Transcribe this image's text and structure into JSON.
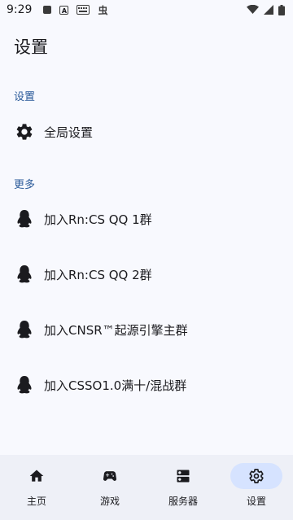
{
  "status_bar": {
    "time": "9:29",
    "icons": [
      "square-notification-icon",
      "font-a-icon",
      "keyboard-icon",
      "app-glyph-icon",
      "wifi-icon",
      "signal-icon",
      "battery-icon"
    ],
    "glyph": "虫"
  },
  "page_title": "设置",
  "sections": [
    {
      "header": "设置",
      "items": [
        {
          "label": "全局设置",
          "icon": "gear-icon"
        }
      ]
    },
    {
      "header": "更多",
      "items": [
        {
          "label": "加入Rn:CS QQ 1群",
          "icon": "qq-penguin-icon"
        },
        {
          "label": "加入Rn:CS QQ 2群",
          "icon": "qq-penguin-icon"
        },
        {
          "label": "加入CNSR™起源引擎主群",
          "icon": "qq-penguin-icon"
        },
        {
          "label": "加入CSSO1.0满十/混战群",
          "icon": "qq-penguin-icon"
        }
      ]
    }
  ],
  "bottom_nav": {
    "items": [
      {
        "label": "主页",
        "icon": "home-icon",
        "active": false
      },
      {
        "label": "游戏",
        "icon": "gamepad-icon",
        "active": false
      },
      {
        "label": "服务器",
        "icon": "server-icon",
        "active": false
      },
      {
        "label": "设置",
        "icon": "gear-icon",
        "active": true
      }
    ]
  },
  "colors": {
    "background": "#f8f9fe",
    "section_header": "#2a5a99",
    "nav_background": "#eef0f7",
    "nav_active_pill": "#d6e3ff"
  }
}
